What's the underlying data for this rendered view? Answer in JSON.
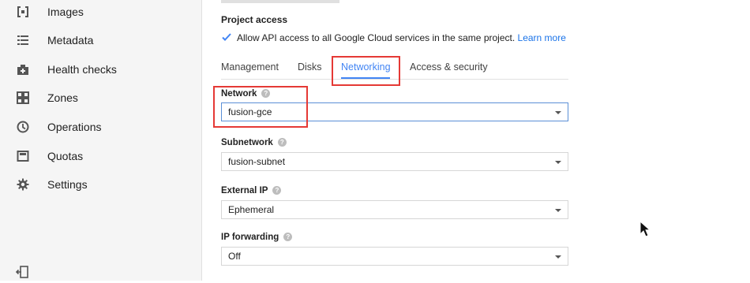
{
  "sidebar": {
    "items": [
      {
        "label": "Images",
        "icon": "images-icon"
      },
      {
        "label": "Metadata",
        "icon": "metadata-icon"
      },
      {
        "label": "Health checks",
        "icon": "health-checks-icon"
      },
      {
        "label": "Zones",
        "icon": "zones-icon"
      },
      {
        "label": "Operations",
        "icon": "operations-icon"
      },
      {
        "label": "Quotas",
        "icon": "quotas-icon"
      },
      {
        "label": "Settings",
        "icon": "gear-icon"
      }
    ],
    "collapse_icon": "collapse-sidebar-icon"
  },
  "project_access": {
    "title": "Project access",
    "checkbox_label": "Allow API access to all Google Cloud services in the same project.",
    "checkbox_checked": true,
    "learn_more": "Learn more"
  },
  "tabs": [
    {
      "label": "Management",
      "active": false
    },
    {
      "label": "Disks",
      "active": false
    },
    {
      "label": "Networking",
      "active": true
    },
    {
      "label": "Access & security",
      "active": false
    }
  ],
  "fields": {
    "network": {
      "label": "Network",
      "value": "fusion-gce"
    },
    "subnetwork": {
      "label": "Subnetwork",
      "value": "fusion-subnet"
    },
    "external_ip": {
      "label": "External IP",
      "value": "Ephemeral"
    },
    "ip_forwarding": {
      "label": "IP forwarding",
      "value": "Off"
    }
  },
  "colors": {
    "accent": "#4285f4",
    "highlight": "#e53935",
    "sidebar_bg": "#f5f5f5"
  }
}
